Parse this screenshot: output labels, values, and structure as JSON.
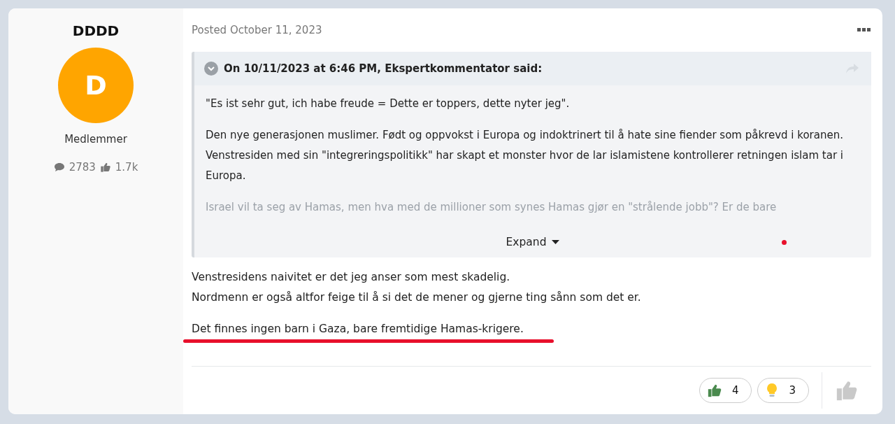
{
  "author": {
    "name": "DDDD",
    "initial": "D",
    "role": "Medlemmer",
    "posts": "2783",
    "reputation": "1.7k"
  },
  "post": {
    "date": "Posted October 11, 2023",
    "quote": {
      "header": "On 10/11/2023 at 6:46 PM, Ekspertkommentator said:",
      "expanded": false,
      "paragraphs": [
        "\"Es ist sehr gut, ich habe freude = Dette er toppers, dette nyter jeg\".",
        "Den nye generasjonen muslimer. Født og oppvokst i Europa og indoktrinert til å hate sine fiender som påkrevd i koranen. Venstresiden med sin \"integreringspolitikk\" har skapt et monster hvor de lar islamistene kontrollerer retningen islam tar i Europa.",
        "Israel vil ta seg av Hamas, men hva med de millioner som synes Hamas gjør en \"strålende jobb\"? Er de bare"
      ],
      "expand_label": "Expand"
    },
    "lines": [
      "Venstresidens naivitet er det jeg anser som mest skadelig.",
      "Nordmenn er også altfor feige til å si det de mener og gjerne ting sånn som det er."
    ],
    "highlighted": "Det finnes ingen barn i Gaza, bare fremtidige Hamas-krigere.",
    "reactions": [
      {
        "kind": "like",
        "count": "4"
      },
      {
        "kind": "idea",
        "count": "3"
      }
    ]
  }
}
